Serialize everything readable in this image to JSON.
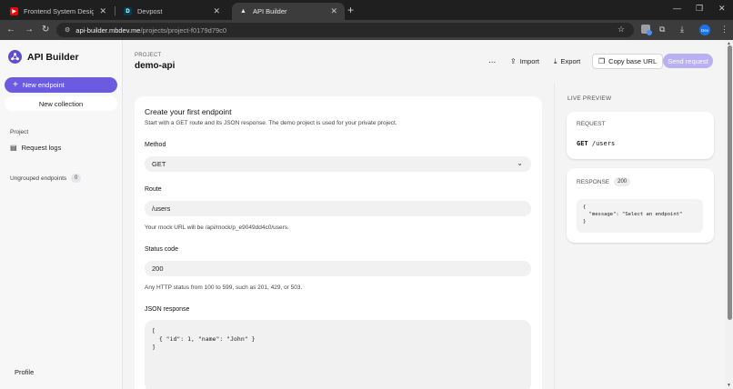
{
  "browser": {
    "tabs": [
      {
        "title": "Frontend System Design Explai",
        "favicon": "youtube",
        "active": false
      },
      {
        "title": "Devpost",
        "favicon": "D",
        "active": false
      },
      {
        "title": "API Builder",
        "favicon": "triangle",
        "active": true
      }
    ],
    "url_host": "api-builder.mbdev.me",
    "url_path": "/projects/project-f0179d79c0",
    "profile_initials": "Dev"
  },
  "sidebar": {
    "brand": "API Builder",
    "new_endpoint": "New endpoint",
    "new_collection": "New collection",
    "project_section": "Project",
    "request_logs": "Request logs",
    "ungrouped_label": "Ungrouped endpoints",
    "ungrouped_count": "0",
    "profile": "Profile"
  },
  "header": {
    "project_label": "PROJECT",
    "project_name": "demo-api",
    "more": "...",
    "import": "Import",
    "export": "Export",
    "copy_base_url": "Copy base URL",
    "send_request": "Send request"
  },
  "form": {
    "title": "Create your first endpoint",
    "description": "Start with a GET route and its JSON response. The demo project is used for your private project.",
    "method_label": "Method",
    "method_value": "GET",
    "route_label": "Route",
    "route_value": "/users",
    "route_help": "Your mock URL will be /api/mock/p_e9049dd4c0/users.",
    "status_label": "Status code",
    "status_value": "200",
    "status_help": "Any HTTP status from 100 to 599, such as 201, 429, or 503.",
    "json_label": "JSON response",
    "json_value": "[\n  { \"id\": 1, \"name\": \"John\" }\n]"
  },
  "preview": {
    "label": "LIVE PREVIEW",
    "request_title": "REQUEST",
    "request_method": "GET",
    "request_path": "/users",
    "response_title": "RESPONSE",
    "response_status": "200",
    "response_body": "{\n  \"message\": \"Select an endpoint\"\n}"
  },
  "colors": {
    "accent": "#6b5be0",
    "accent_disabled": "#b9b0f2"
  }
}
